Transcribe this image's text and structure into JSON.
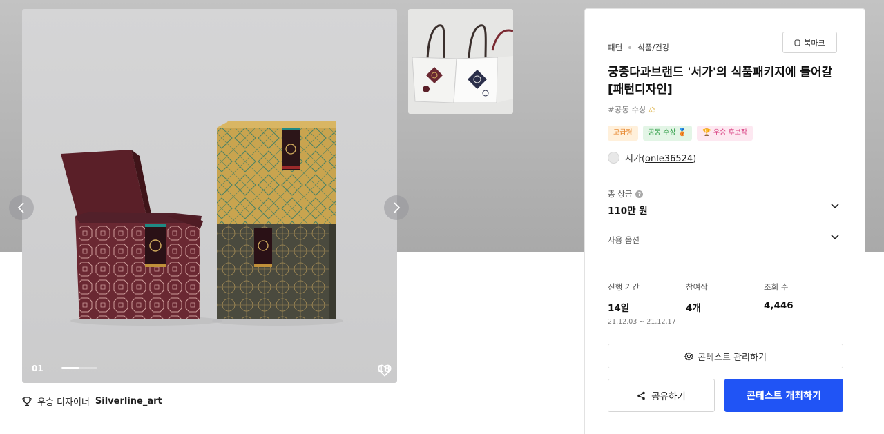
{
  "gallery": {
    "slide_index": "01",
    "slide_progress": 0.5,
    "like_count": "18",
    "winner_prefix": "우승 디자이너",
    "winner_name": "Silverline_art"
  },
  "contest": {
    "category": "패턴",
    "subcategory": "식품/건강",
    "bookmark_label": "북마크",
    "title": "궁중다과브랜드 '서가'의 식품패키지에 들어갈 [패턴디자인]",
    "hashtag": "#공동 수상",
    "badges": [
      "고급형",
      "공동 수상",
      "우승 후보작"
    ],
    "owner_name": "서가",
    "owner_id": "onle36524",
    "prize_label": "총 상금",
    "prize_value": "110만 원",
    "usage_label": "사용 옵션",
    "stats": {
      "period_label": "진행 기간",
      "period_value": "14일",
      "period_range": "21.12.03 ~ 21.12.17",
      "entries_label": "참여작",
      "entries_value": "4개",
      "views_label": "조회 수",
      "views_value": "4,446"
    },
    "manage_label": "콘테스트 관리하기",
    "share_label": "공유하기",
    "host_label": "콘테스트 개최하기"
  },
  "colors": {
    "primary": "#2054f5",
    "box_burgundy": "#6a2832",
    "box_gold": "#c9a44f",
    "box_olive": "#4a4a3e"
  },
  "icons": [
    "trophy-icon",
    "heart-icon",
    "bookmark-icon",
    "help-icon",
    "chevron-down-icon",
    "gear-icon",
    "share-icon",
    "chevron-left-icon",
    "chevron-right-icon"
  ]
}
